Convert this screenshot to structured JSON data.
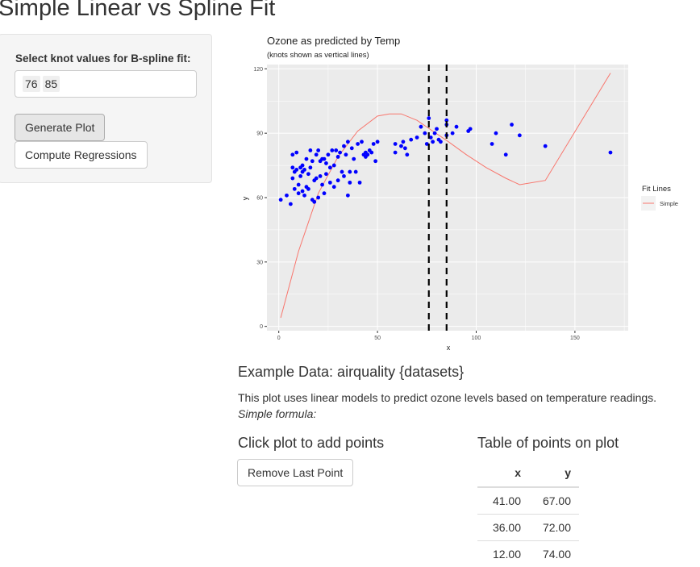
{
  "page": {
    "title": "Simple Linear vs Spline Fit"
  },
  "sidebar": {
    "knot_label": "Select knot values for B-spline fit:",
    "knots": [
      "76",
      "85"
    ],
    "generate_button": "Generate Plot",
    "compute_button": "Compute Regressions"
  },
  "plot": {
    "title": "Ozone as predicted by Temp",
    "subtitle": "(knots shown as vertical lines)",
    "xlabel": "x",
    "ylabel": "y",
    "legend_title": "Fit Lines",
    "legend_item": "Simple"
  },
  "chart_data": {
    "type": "scatter",
    "title": "Ozone as predicted by Temp",
    "subtitle": "(knots shown as vertical lines)",
    "xlabel": "x",
    "ylabel": "y",
    "xlim": [
      -6,
      177
    ],
    "ylim": [
      -2,
      122
    ],
    "xticks": [
      0,
      50,
      100,
      150
    ],
    "yticks": [
      0,
      30,
      60,
      90,
      120
    ],
    "grid": true,
    "legend": {
      "title": "Fit Lines",
      "entries": [
        "Simple"
      ],
      "position": "right"
    },
    "colors": {
      "points": "#0000ff",
      "fit": "#f8766d",
      "knots": "#000000",
      "panel": "#ebebeb"
    },
    "knots": [
      76,
      85
    ],
    "points": {
      "x": [
        1,
        4,
        6,
        7,
        7,
        7,
        8,
        8,
        9,
        9,
        10,
        10,
        11,
        11,
        12,
        12,
        12,
        13,
        13,
        14,
        14,
        15,
        15,
        16,
        16,
        17,
        17,
        18,
        18,
        19,
        19,
        20,
        20,
        21,
        21,
        22,
        22,
        23,
        23,
        24,
        24,
        25,
        26,
        26,
        27,
        28,
        28,
        29,
        30,
        30,
        31,
        32,
        33,
        33,
        34,
        35,
        35,
        36,
        36,
        37,
        38,
        39,
        40,
        41,
        42,
        43,
        44,
        44,
        45,
        46,
        47,
        48,
        49,
        50,
        59,
        59,
        62,
        63,
        64,
        65,
        67,
        70,
        72,
        74,
        75,
        76,
        77,
        78,
        79,
        80,
        81,
        82,
        85,
        85,
        85,
        88,
        90,
        96,
        97,
        108,
        110,
        115,
        118,
        122,
        135,
        168
      ],
      "y": [
        59,
        61,
        57,
        69,
        74,
        80,
        64,
        72,
        81,
        73,
        62,
        66,
        70,
        74,
        75,
        72,
        63,
        61,
        73,
        65,
        78,
        71,
        64,
        82,
        74,
        59,
        77,
        58,
        68,
        80,
        69,
        60,
        82,
        70,
        77,
        78,
        66,
        62,
        78,
        76,
        71,
        80,
        67,
        74,
        82,
        75,
        65,
        82,
        79,
        68,
        81,
        72,
        84,
        70,
        80,
        61,
        86,
        67,
        72,
        83,
        78,
        72,
        85,
        67,
        86,
        80,
        79,
        81,
        80,
        82,
        81,
        85,
        77,
        86,
        85,
        81,
        84,
        86,
        83,
        80,
        87,
        88,
        93,
        90,
        85,
        97,
        88,
        86,
        90,
        92,
        87,
        86,
        89,
        94,
        96,
        90,
        93,
        91,
        92,
        85,
        90,
        80,
        94,
        89,
        84,
        81
      ]
    },
    "fit_line": {
      "name": "Simple",
      "x": [
        1,
        10,
        20,
        30,
        40,
        50,
        56,
        62,
        70,
        78,
        86,
        95,
        105,
        115,
        122,
        135,
        168
      ],
      "y": [
        4,
        35,
        62,
        79,
        91,
        98,
        99,
        99,
        96,
        91,
        86,
        80,
        74,
        69,
        66,
        68,
        118
      ]
    }
  },
  "main": {
    "example_heading": "Example Data: airquality {datasets}",
    "description": "This plot uses linear models to predict ozone levels based on temperature readings.",
    "formula_label": "Simple formula:",
    "click_heading": "Click plot to add points",
    "remove_button": "Remove Last Point",
    "table_heading": "Table of points on plot",
    "table": {
      "columns": [
        "x",
        "y"
      ],
      "rows": [
        [
          "41.00",
          "67.00"
        ],
        [
          "36.00",
          "72.00"
        ],
        [
          "12.00",
          "74.00"
        ]
      ]
    }
  }
}
